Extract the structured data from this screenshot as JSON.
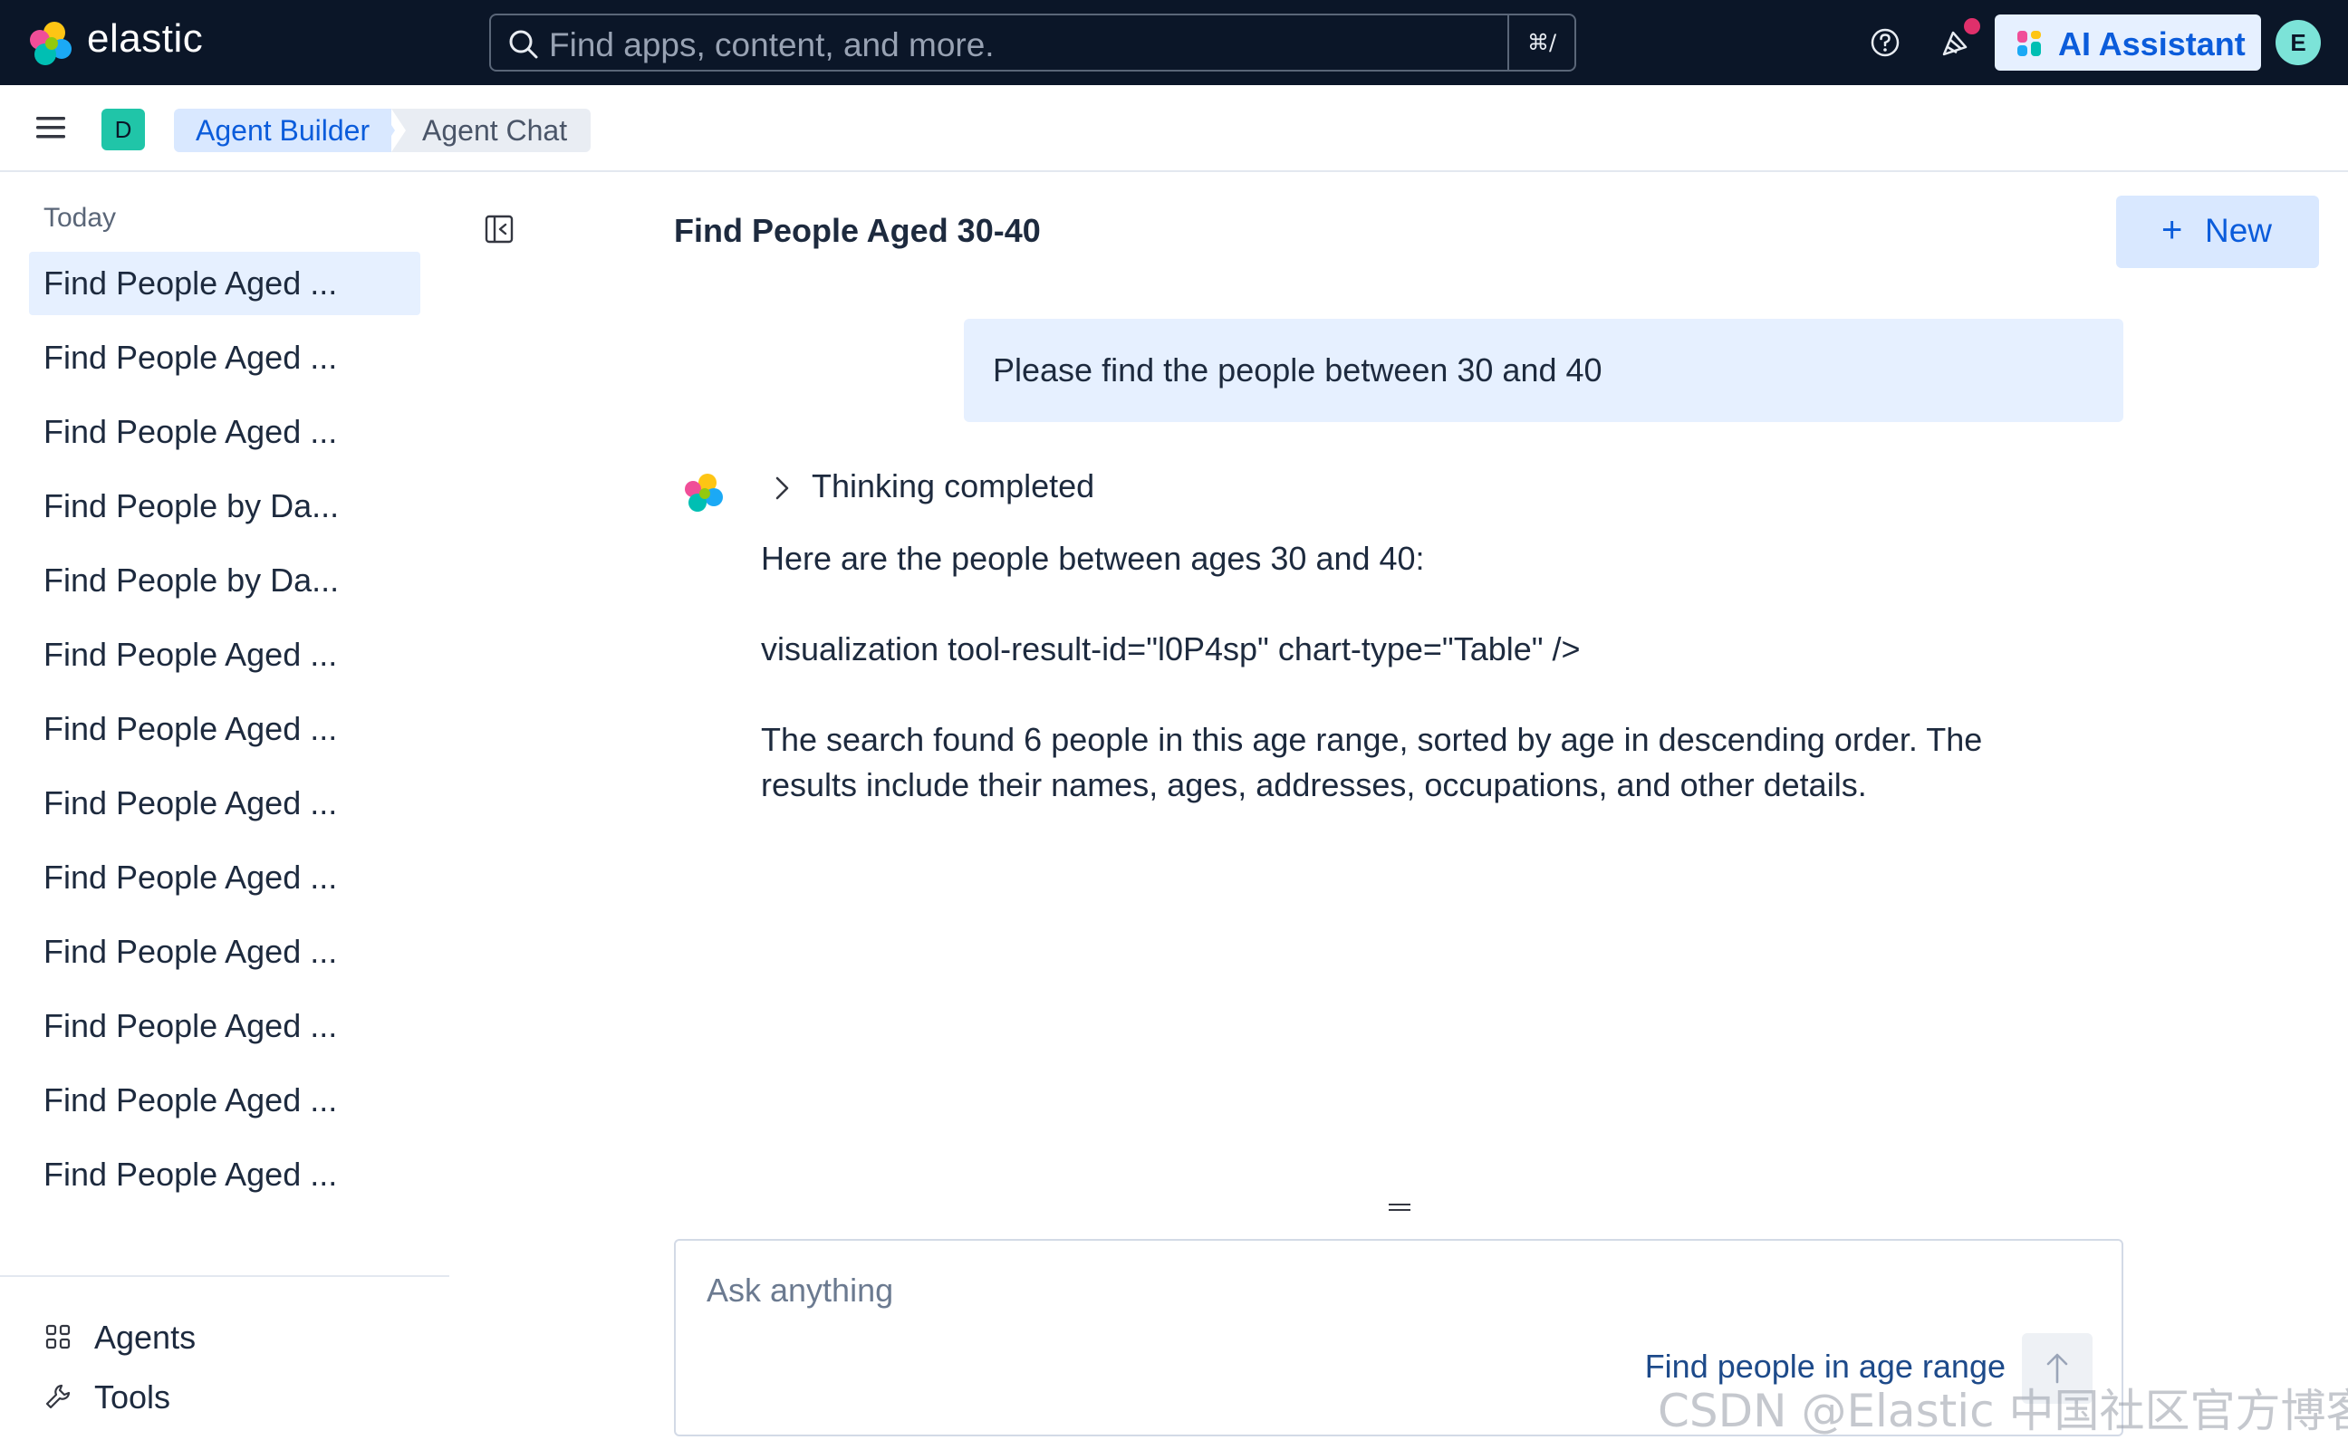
{
  "header": {
    "brand": "elastic",
    "search_placeholder": "Find apps, content, and more.",
    "search_shortcut": "⌘/",
    "ai_assistant_label": "AI Assistant",
    "user_initial": "E",
    "has_news_indicator": true
  },
  "breadcrumbs": {
    "space_badge": "D",
    "items": [
      "Agent Builder",
      "Agent Chat"
    ]
  },
  "sidebar": {
    "heading": "Today",
    "conversations": [
      "Find People Aged ...",
      "Find People Aged ...",
      "Find People Aged ...",
      "Find People by Da...",
      "Find People by Da...",
      "Find People Aged ...",
      "Find People Aged ...",
      "Find People Aged ...",
      "Find People Aged ...",
      "Find People Aged ...",
      "Find People Aged ...",
      "Find People Aged ...",
      "Find People Aged ..."
    ],
    "active_index": 0,
    "links": [
      "Agents",
      "Tools"
    ]
  },
  "conversation": {
    "title": "Find People Aged 30-40",
    "new_label": "New",
    "user_message": "Please find the people between 30 and 40",
    "thinking_label": "Thinking completed",
    "response_intro": "Here are the people between ages 30 and 40:",
    "response_viz": "visualization tool-result-id=\"l0P4sp\" chart-type=\"Table\" />",
    "response_line1": "The search found 6 people in this age range, sorted by age in descending order. The",
    "response_line2": "results include their names, ages, addresses, occupations, and other details."
  },
  "composer": {
    "placeholder": "Ask anything",
    "agent_label": "Find people in age range"
  },
  "watermark": "CSDN @Elastic 中国社区官方博客",
  "colors": {
    "header_bg": "#0b1628",
    "accent": "#0b5cdb",
    "active_bg": "#e6f0ff"
  }
}
